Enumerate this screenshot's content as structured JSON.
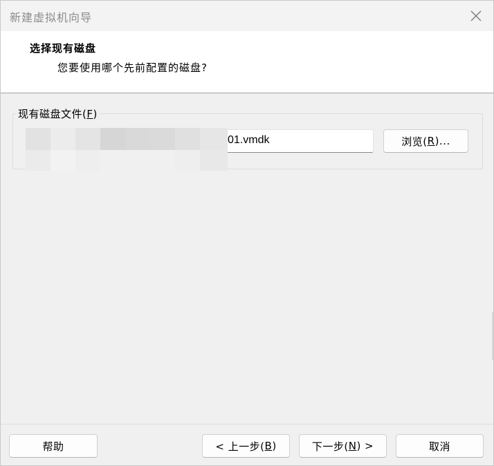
{
  "window": {
    "title": "新建虚拟机向导"
  },
  "header": {
    "title": "选择现有磁盘",
    "subtitle": "您要使用哪个先前配置的磁盘?"
  },
  "disk_group": {
    "label_prefix": "现有磁盘文件(",
    "label_mnemonic": "F",
    "label_suffix": ")",
    "path_visible_suffix": "01.vmdk",
    "browse_prefix": "浏览(",
    "browse_mnemonic": "R",
    "browse_suffix": ")..."
  },
  "footer": {
    "help": "帮助",
    "back_prefix": "< 上一步(",
    "back_mnemonic": "B",
    "back_suffix": ")",
    "next_prefix": "下一步(",
    "next_mnemonic": "N",
    "next_suffix": ") >",
    "cancel": "取消"
  },
  "icons": {
    "close": "close-icon"
  }
}
